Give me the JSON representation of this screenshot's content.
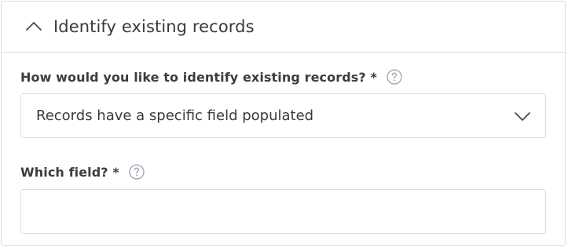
{
  "section": {
    "title": "Identify existing records",
    "expanded": true,
    "toggle_icon": "chevron-up-icon"
  },
  "fields": {
    "identify": {
      "label": "How would you like to identify existing records? *",
      "help_icon": "question-circle-icon",
      "selected_value": "Records have a specific field populated",
      "dropdown_icon": "chevron-down-icon"
    },
    "which_field": {
      "label": "Which field? *",
      "help_icon": "question-circle-icon",
      "value": ""
    }
  },
  "colors": {
    "border": "#d9dde3",
    "text": "#3a3a3a",
    "icon": "#4a4a4a",
    "help_icon": "#9aa4ae"
  }
}
